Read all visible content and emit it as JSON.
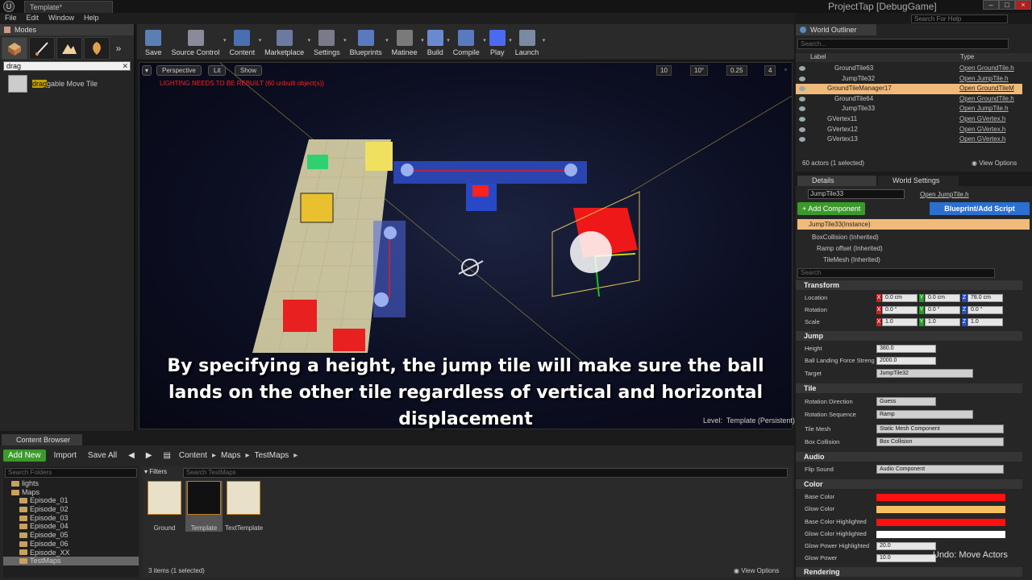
{
  "window": {
    "doc_tab": "Template*",
    "app_title": "ProjectTap [DebugGame]",
    "search_help_placeholder": "Search For Help"
  },
  "menu": [
    "File",
    "Edit",
    "Window",
    "Help"
  ],
  "modes": {
    "title": "Modes",
    "search_value": "drag",
    "result_highlight": "drag",
    "result_rest": "gable Move Tile"
  },
  "toolbar": [
    {
      "label": "Save",
      "color": "#5a7fb5"
    },
    {
      "label": "Source Control",
      "color": "#8a8a9a"
    },
    {
      "label": "Content",
      "color": "#4a6fb0"
    },
    {
      "label": "Marketplace",
      "color": "#6a7aa0"
    },
    {
      "label": "Settings",
      "color": "#7a7a8a"
    },
    {
      "label": "Blueprints",
      "color": "#5a7abf"
    },
    {
      "label": "Matinee",
      "color": "#7a7a7a"
    },
    {
      "label": "Build",
      "color": "#6a8ad0"
    },
    {
      "label": "Compile",
      "color": "#5a7ac0"
    },
    {
      "label": "Play",
      "color": "#4a6af0"
    },
    {
      "label": "Launch",
      "color": "#7a8aa0"
    }
  ],
  "viewport": {
    "perspective": "Perspective",
    "lit": "Lit",
    "show": "Show",
    "snap_values": [
      "10",
      "10°",
      "0.25",
      "4"
    ],
    "lighting_warning": "LIGHTING NEEDS TO BE REBUILT (60 unbuilt object(s))",
    "subtitle_lines": [
      "By specifying a height, the jump tile will make sure the ball",
      "lands on the other tile regardless of vertical and horizontal",
      "displacement"
    ],
    "level_label": "Level:",
    "level_value": "Template (Persistent)"
  },
  "content_browser": {
    "tab": "Content Browser",
    "add_new": "Add New",
    "import": "Import",
    "save_all": "Save All",
    "breadcrumb": [
      "Content",
      "Maps",
      "TestMaps"
    ],
    "search_folders_placeholder": "Search Folders",
    "folders": [
      {
        "name": "lights",
        "indent": 1,
        "selected": false
      },
      {
        "name": "Maps",
        "indent": 1,
        "selected": false
      },
      {
        "name": "Episode_01",
        "indent": 2,
        "selected": false
      },
      {
        "name": "Episode_02",
        "indent": 2,
        "selected": false
      },
      {
        "name": "Episode_03",
        "indent": 2,
        "selected": false
      },
      {
        "name": "Episode_04",
        "indent": 2,
        "selected": false
      },
      {
        "name": "Episode_05",
        "indent": 2,
        "selected": false
      },
      {
        "name": "Episode_06",
        "indent": 2,
        "selected": false
      },
      {
        "name": "Episode_XX",
        "indent": 2,
        "selected": false
      },
      {
        "name": "TestMaps",
        "indent": 2,
        "selected": true
      }
    ],
    "filters": "Filters",
    "search_assets_placeholder": "Search TestMaps",
    "assets": [
      {
        "name": "Ground",
        "selected": false
      },
      {
        "name": "Template",
        "selected": true
      },
      {
        "name": "TextTemplate",
        "selected": false
      }
    ],
    "status": "3 items (1 selected)",
    "view_options": "View Options"
  },
  "outliner": {
    "tab": "World Outliner",
    "search_placeholder": "Search...",
    "col_label": "Label",
    "col_type": "Type",
    "rows": [
      {
        "label": "GroundTile63",
        "type": "Open GroundTile.h",
        "indent": 2,
        "selected": false
      },
      {
        "label": "JumpTile32",
        "type": "Open JumpTile.h",
        "indent": 3,
        "selected": false
      },
      {
        "label": "GroundTileManager17",
        "type": "Open GroundTileM",
        "indent": 1,
        "selected": true
      },
      {
        "label": "GroundTile64",
        "type": "Open GroundTile.h",
        "indent": 2,
        "selected": false
      },
      {
        "label": "JumpTile33",
        "type": "Open JumpTile.h",
        "indent": 3,
        "selected": false
      },
      {
        "label": "GVertex11",
        "type": "Open GVertex.h",
        "indent": 1,
        "selected": false
      },
      {
        "label": "GVertex12",
        "type": "Open GVertex.h",
        "indent": 1,
        "selected": false
      },
      {
        "label": "GVertex13",
        "type": "Open GVertex.h",
        "indent": 1,
        "selected": false
      }
    ],
    "footer": "60 actors (1 selected)",
    "view_options": "View Options"
  },
  "details": {
    "tab_details": "Details",
    "tab_world": "World Settings",
    "name_value": "JumpTile33",
    "open_link": "Open JumpTile.h",
    "add_component": "+ Add Component",
    "blueprint_btn": "Blueprint/Add Script",
    "instance": "JumpTile33(Instance)",
    "components": [
      "BoxCollision (Inherited)",
      "Ramp offset (Inherited)",
      "TileMesh (Inherited)"
    ],
    "search_placeholder": "Search",
    "transform": {
      "title": "Transform",
      "location_label": "Location",
      "rotation_label": "Rotation",
      "scale_label": "Scale",
      "location": [
        "0.0 cm",
        "0.0 cm",
        "78.0 cm"
      ],
      "rotation": [
        "0.0 °",
        "0.0 °",
        "0.0 °"
      ],
      "scale": [
        "1.0",
        "1.0",
        "1.0"
      ]
    },
    "jump": {
      "title": "Jump",
      "height_label": "Height",
      "height": "380.0",
      "force_label": "Ball Landing Force Streng",
      "force": "2000.0",
      "target_label": "Target",
      "target": "JumpTile32"
    },
    "tile": {
      "title": "Tile",
      "rot_dir_label": "Rotation Direction",
      "rot_dir": "Guess",
      "rot_seq_label": "Rotation Sequence",
      "rot_seq": "Ramp",
      "mesh_label": "Tile Mesh",
      "mesh": "Static Mesh Component",
      "box_label": "Box Collision",
      "box": "Box Collision"
    },
    "audio": {
      "title": "Audio",
      "flip_label": "Flip Sound",
      "flip": "Audio Component"
    },
    "color": {
      "title": "Color",
      "rows": [
        {
          "label": "Base Color",
          "color": "#ff1010"
        },
        {
          "label": "Glow Color",
          "color": "#f6c060"
        },
        {
          "label": "Base Color Highlighted",
          "color": "#ff1010"
        },
        {
          "label": "Glow Color Highlighted",
          "color": "#ffffff"
        }
      ],
      "glow_high_label": "Glow Power Highlighted",
      "glow_high": "20.0",
      "glow_label": "Glow Power",
      "glow": "10.0"
    },
    "rendering": "Rendering"
  },
  "undo_toast": "Undo: Move Actors"
}
